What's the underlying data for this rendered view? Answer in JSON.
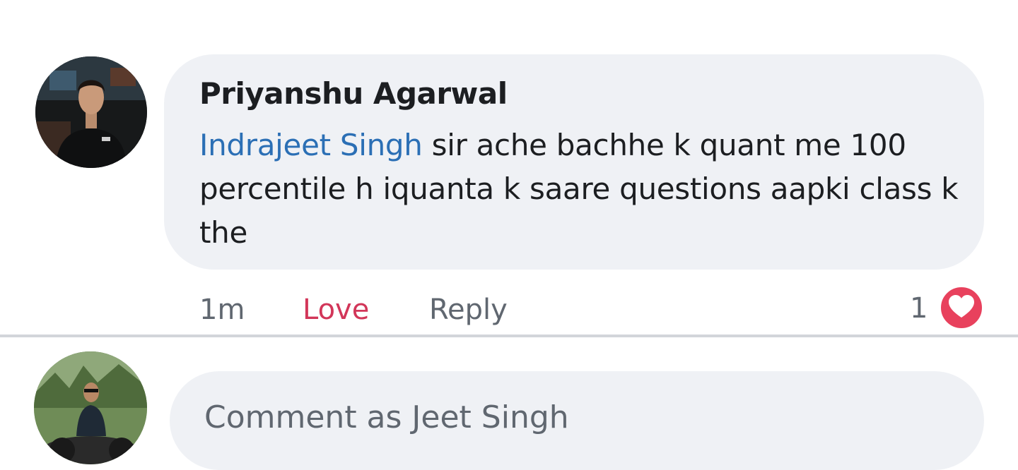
{
  "comment": {
    "author": "Priyanshu Agarwal",
    "mention": "Indrajeet Singh",
    "text": " sir ache bachhe k quant me 100 percentile h iquanta k saare questions aapki class k the",
    "time": "1m",
    "love_label": "Love",
    "reply_label": "Reply",
    "reaction_count": "1",
    "reaction_icon": "heart-icon"
  },
  "composer": {
    "placeholder": "Comment as Jeet Singh"
  },
  "colors": {
    "bubble": "#eff1f5",
    "mention": "#2b6fb5",
    "love": "#d23659",
    "heart": "#e8415d",
    "muted_text": "#606770"
  }
}
